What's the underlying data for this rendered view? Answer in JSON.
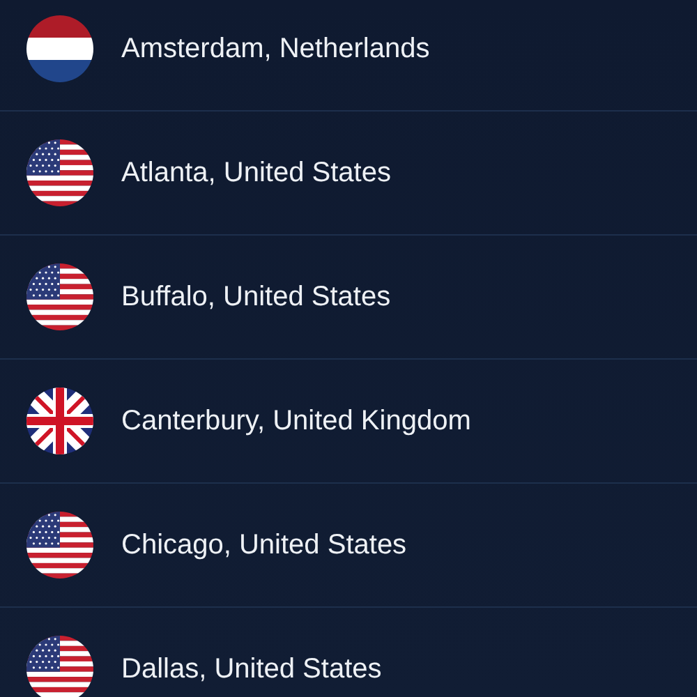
{
  "locations": [
    {
      "label": "Amsterdam, Netherlands",
      "kind": "nl"
    },
    {
      "label": "Atlanta, United States",
      "kind": "us"
    },
    {
      "label": "Buffalo, United States",
      "kind": "us"
    },
    {
      "label": "Canterbury, United Kingdom",
      "kind": "uk"
    },
    {
      "label": "Chicago, United States",
      "kind": "us"
    },
    {
      "label": "Dallas, United States",
      "kind": "us"
    }
  ]
}
